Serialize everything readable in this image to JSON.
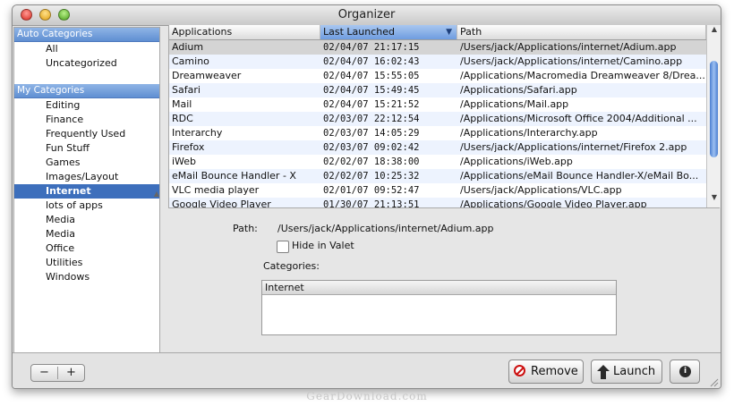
{
  "window": {
    "title": "Organizer"
  },
  "sidebar": {
    "auto_header": "Auto Categories",
    "auto_items": [
      "All",
      "Uncategorized"
    ],
    "my_header": "My Categories",
    "my_items": [
      "Editing",
      "Finance",
      "Frequently Used",
      "Fun Stuff",
      "Games",
      "Images/Layout",
      "Internet",
      "lots of apps",
      "Media",
      "Media",
      "Office",
      "Utilities",
      "Windows"
    ],
    "selected_item": "Internet"
  },
  "table": {
    "columns": [
      "Applications",
      "Last Launched",
      "Path"
    ],
    "sorted_column": "Last Launched",
    "rows": [
      [
        "Adium",
        "02/04/07 21:17:15",
        "/Users/jack/Applications/internet/Adium.app"
      ],
      [
        "Camino",
        "02/04/07 16:02:43",
        "/Users/jack/Applications/internet/Camino.app"
      ],
      [
        "Dreamweaver",
        "02/04/07 15:55:05",
        "/Applications/Macromedia Dreamweaver 8/Drea..."
      ],
      [
        "Safari",
        "02/04/07 15:49:45",
        "/Applications/Safari.app"
      ],
      [
        "Mail",
        "02/04/07 15:21:52",
        "/Applications/Mail.app"
      ],
      [
        "RDC",
        "02/03/07 22:12:54",
        "/Applications/Microsoft Office 2004/Additional ..."
      ],
      [
        "Interarchy",
        "02/03/07 14:05:29",
        "/Applications/Interarchy.app"
      ],
      [
        "Firefox",
        "02/03/07 09:02:42",
        "/Users/jack/Applications/internet/Firefox 2.app"
      ],
      [
        "iWeb",
        "02/02/07 18:38:00",
        "/Applications/iWeb.app"
      ],
      [
        "eMail Bounce Handler - X",
        "02/02/07 10:25:32",
        "/Applications/eMail Bounce Handler-X/eMail Bo..."
      ],
      [
        "VLC media player",
        "02/01/07 09:52:47",
        "/Users/jack/Applications/VLC.app"
      ],
      [
        "Google Video Player",
        "01/30/07 21:13:51",
        "/Applications/Google Video Player.app"
      ]
    ],
    "selected_row": 0
  },
  "detail": {
    "path_label": "Path:",
    "path_value": "/Users/jack/Applications/internet/Adium.app",
    "hide_label": "Hide in Valet",
    "hide_checked": false,
    "categories_label": "Categories:",
    "categories": [
      "Internet"
    ]
  },
  "toolbar": {
    "minus": "−",
    "plus": "+",
    "remove": "Remove",
    "launch": "Launch",
    "info": "i"
  },
  "colors": {
    "selection": "#3d6fbc",
    "stripe": "#edf3fe",
    "remove_red": "#cc1010"
  },
  "watermark": "GearDownload.com"
}
